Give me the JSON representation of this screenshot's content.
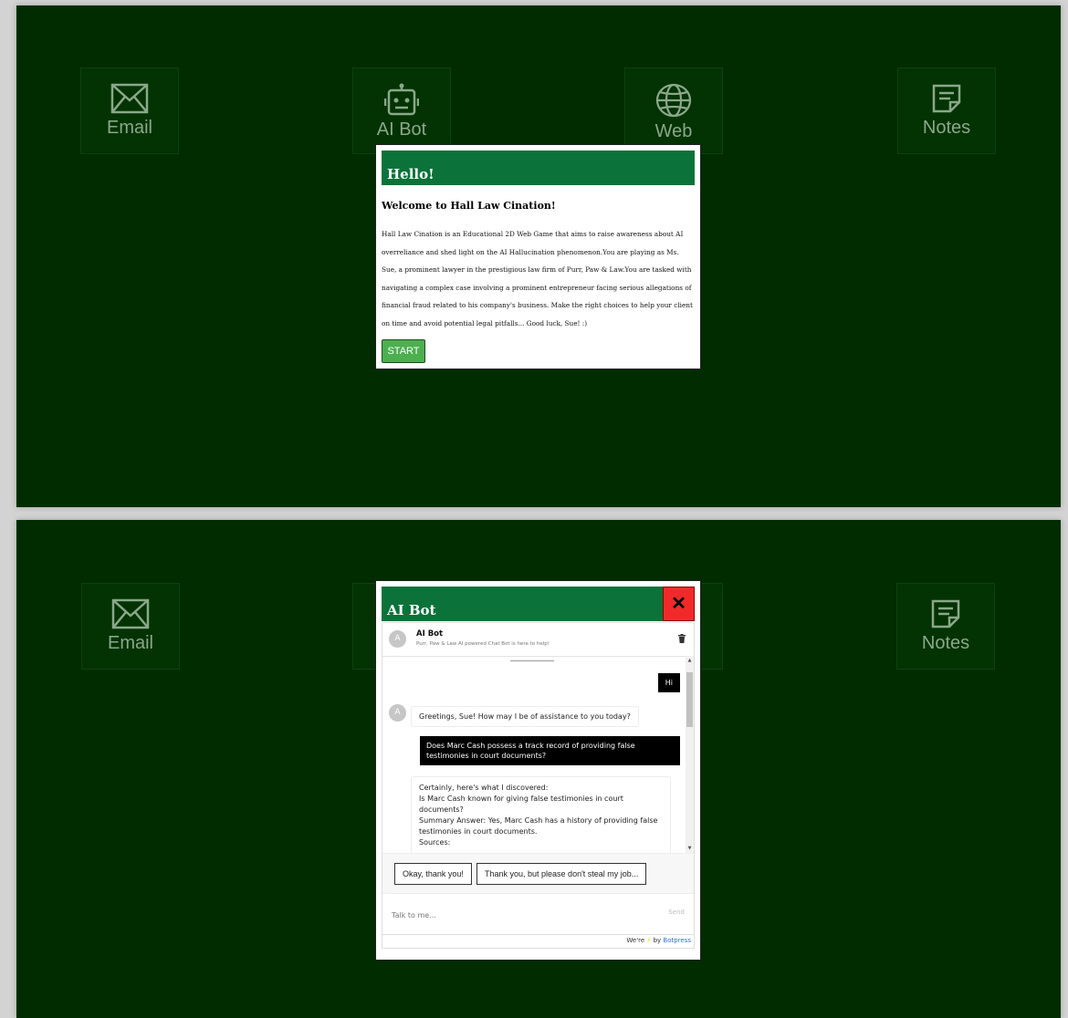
{
  "desktop_top": {
    "icons": [
      {
        "label": "Email",
        "icon": "mail-icon"
      },
      {
        "label": "AI Bot",
        "icon": "robot-icon"
      },
      {
        "label": "Web",
        "icon": "globe-icon"
      },
      {
        "label": "Notes",
        "icon": "note-icon"
      }
    ]
  },
  "desktop_bottom": {
    "icons": [
      {
        "label": "Email",
        "icon": "mail-icon"
      },
      {
        "label": "Notes",
        "icon": "note-icon"
      }
    ]
  },
  "welcome_modal": {
    "title": "Hello!",
    "subtitle": "Welcome to Hall Law Cination!",
    "body": "Hall Law Cination is an Educational 2D Web Game that aims to raise awareness about AI overreliance and shed light on the AI Hallucination phenomenon.You are playing as Ms. Sue, a prominent lawyer in the prestigious law firm of Purr, Paw & Law.You are tasked with navigating a complex case involving a prominent entrepreneur facing serious allegations of financial fraud related to his company's business. Make the right choices to help your client on time and avoid potential legal pitfalls... Good luck, Sue! :)",
    "start_label": "START"
  },
  "chat_modal": {
    "title": "AI Bot",
    "close_symbol": "✕",
    "bot": {
      "avatar_letter": "A",
      "name": "AI Bot",
      "description": "Purr, Paw & Law AI powered Chat Bot is here to help!"
    },
    "messages": {
      "user_1": "Hi",
      "bot_1": "Greetings, Sue! How may I be of assistance to you today?",
      "user_2": "Does Marc Cash possess a track record of providing false testimonies in court documents?",
      "bot_2": "Certainly, here's what I discovered:\nIs Marc Cash known for giving false testimonies in court documents?\nSummary Answer: Yes, Marc Cash has a history of providing false testimonies in court documents.\nSources:"
    },
    "quick_replies": [
      "Okay, thank you!",
      "Thank you, but please don't steal my job..."
    ],
    "composer": {
      "placeholder": "Talk to me...",
      "send_label": "Send"
    },
    "footer": {
      "prefix": "We're",
      "bolt": "⚡",
      "by": "by",
      "brand": "Botpress"
    }
  },
  "colors": {
    "desktop_bg": "#002c00",
    "modal_header": "#0b7339",
    "start_button": "#4caf50",
    "close_button": "#f02a2a"
  }
}
